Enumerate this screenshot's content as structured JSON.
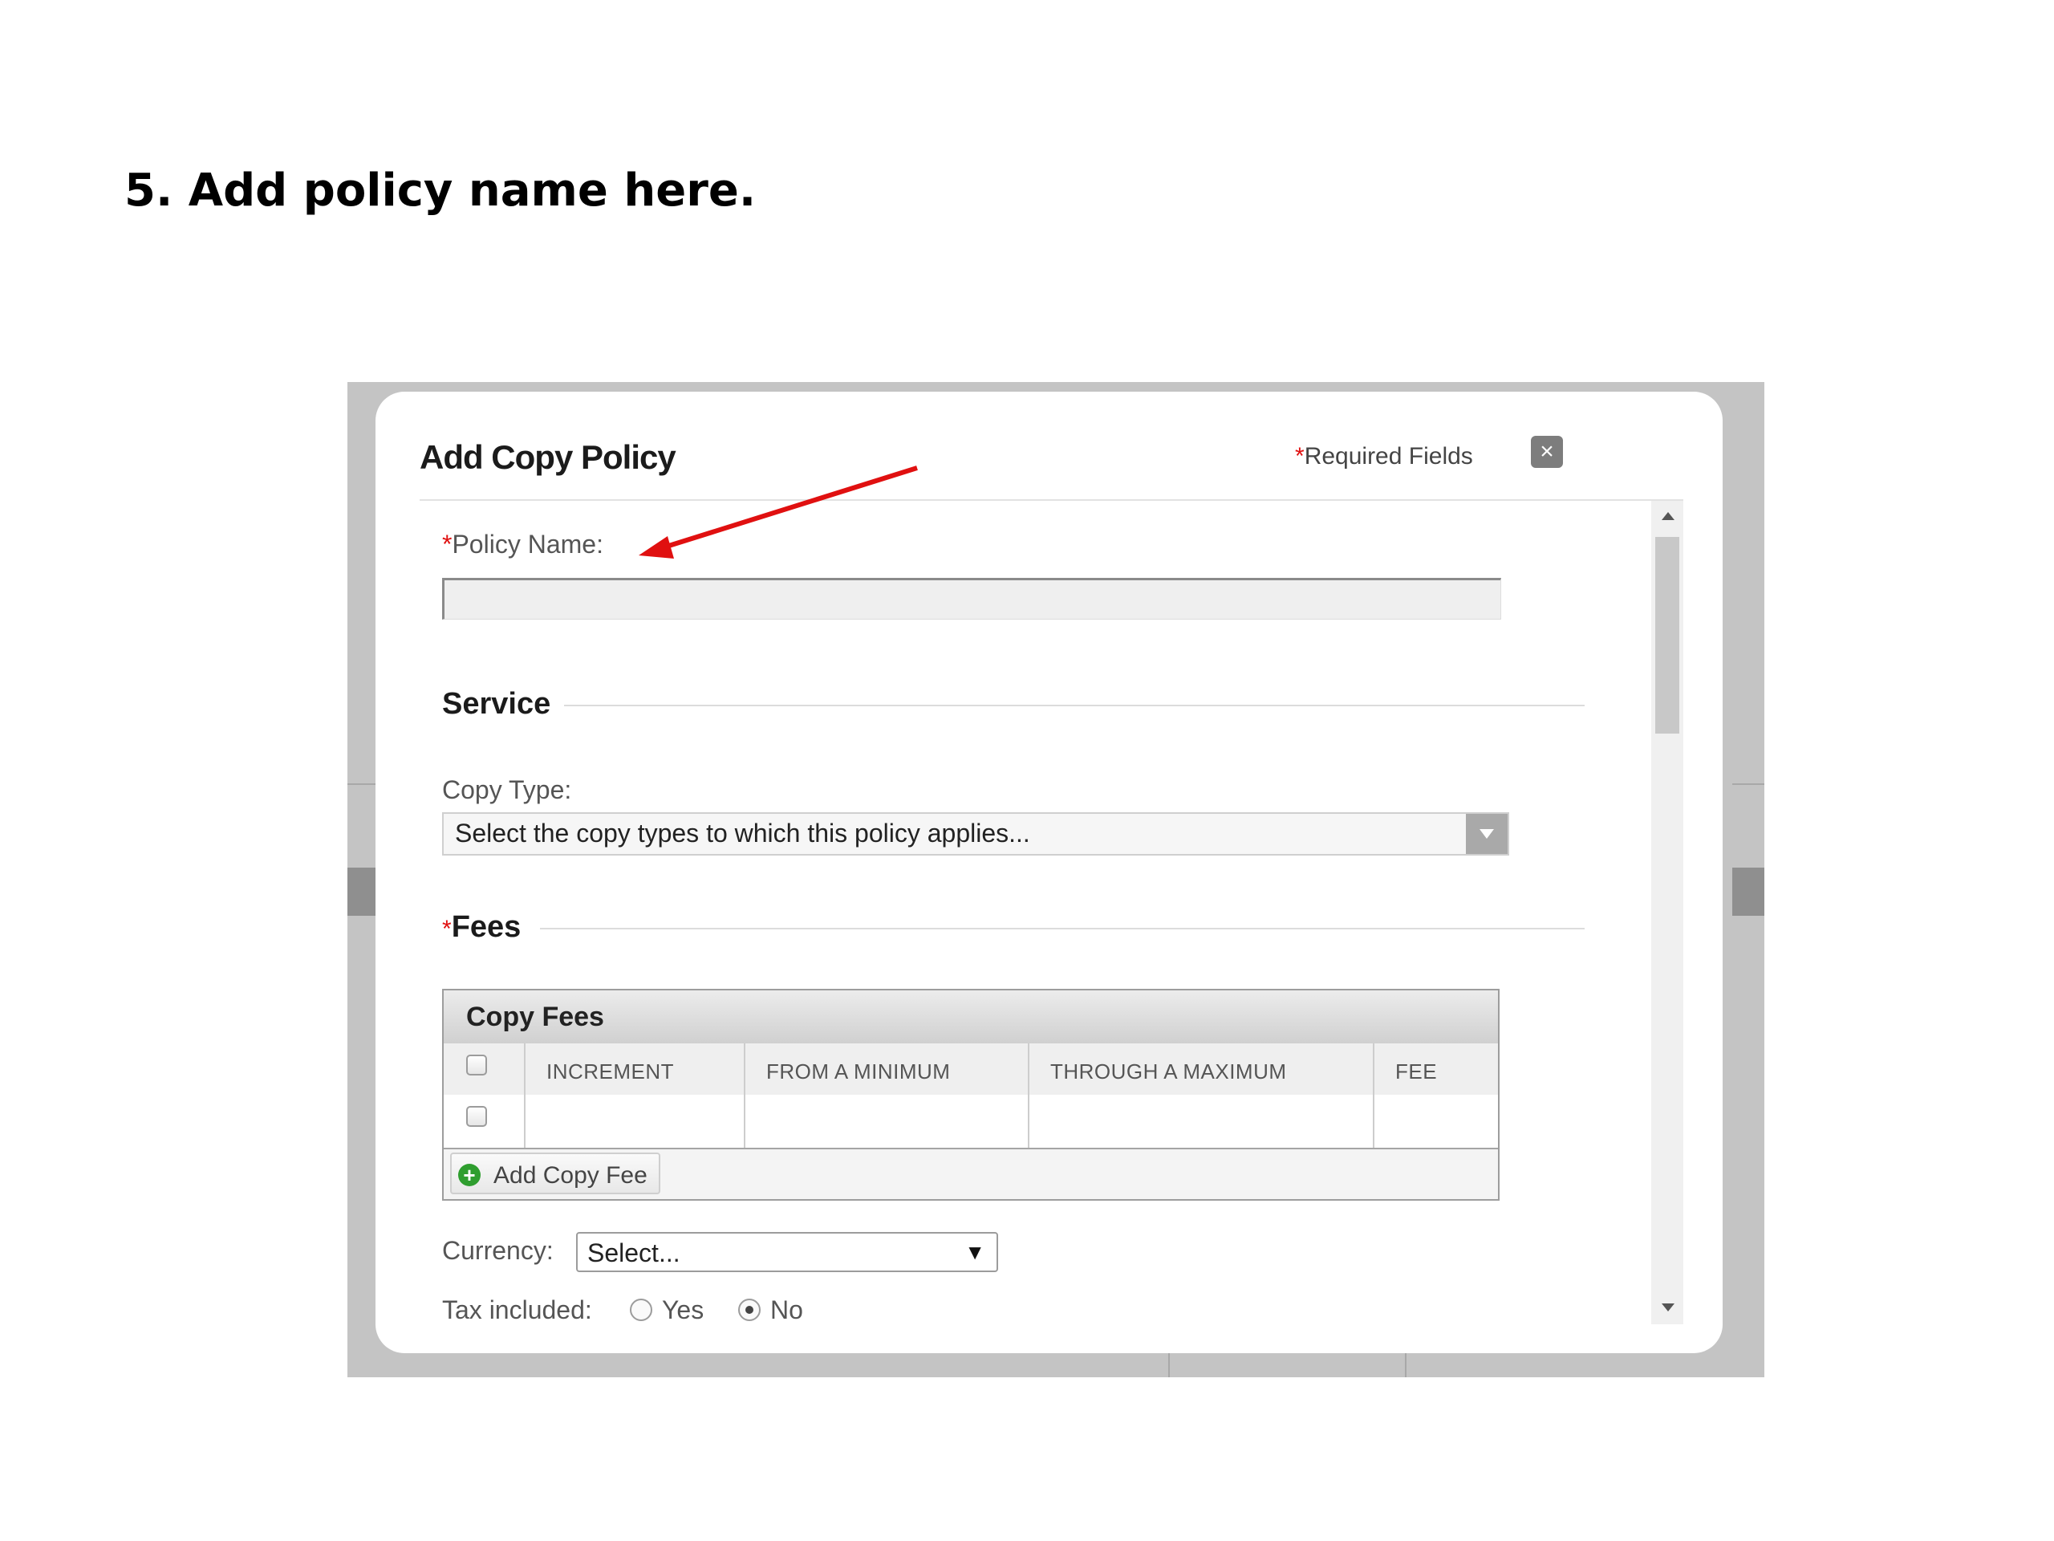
{
  "step_title": "5. Add policy name here.",
  "dialog": {
    "title": "Add Copy Policy",
    "required_star": "*",
    "required_note": "Required Fields",
    "close_icon": "close-icon"
  },
  "policy_name": {
    "star": "*",
    "label": "Policy Name:",
    "value": ""
  },
  "service": {
    "heading": "Service",
    "copy_type_label": "Copy Type:",
    "copy_type_placeholder": "Select the copy types to which this policy applies..."
  },
  "fees": {
    "star": "*",
    "heading": "Fees",
    "panel_title": "Copy Fees",
    "columns": [
      "INCREMENT",
      "FROM A MINIMUM",
      "THROUGH A MAXIMUM",
      "FEE"
    ],
    "rows": [
      [
        "",
        "",
        "",
        ""
      ]
    ],
    "add_button": "Add Copy Fee"
  },
  "currency": {
    "label": "Currency:",
    "selected": "Select..."
  },
  "tax": {
    "label": "Tax included:",
    "options": [
      "Yes",
      "No"
    ],
    "selected": "No"
  },
  "annotation_color": "#e01010"
}
